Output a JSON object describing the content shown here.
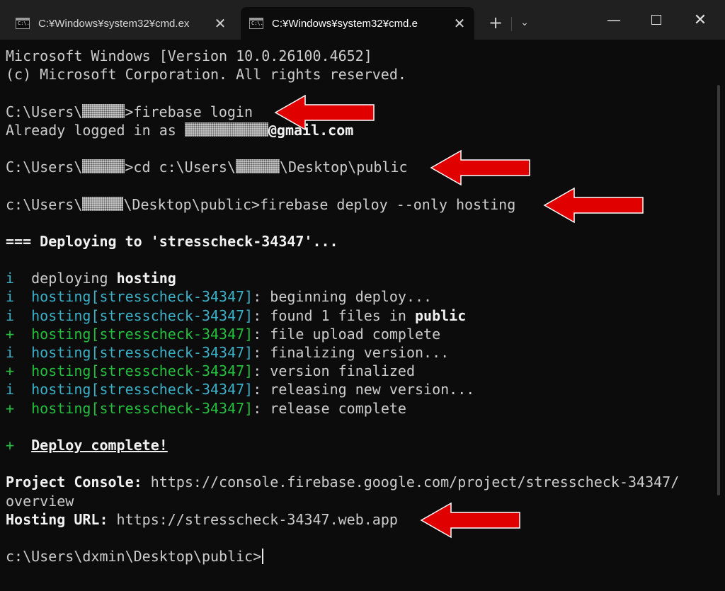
{
  "window": {
    "tabs": [
      {
        "title": "C:¥Windows¥system32¥cmd.ex",
        "close": "✕",
        "icon_text": "C:\\."
      },
      {
        "title": "C:¥Windows¥system32¥cmd.e",
        "close": "✕",
        "icon_text": "C:\\."
      }
    ],
    "new_tab": "+",
    "dropdown": "⌄",
    "minimize": "—",
    "close": "✕"
  },
  "console": {
    "l0": "Microsoft Windows [Version 10.0.26100.4652]",
    "l1": "(c) Microsoft Corporation. All rights reserved.",
    "l3_prefix": "C:\\Users\\",
    "l3_cmd": ">firebase login",
    "l4_prefix": "Already logged in as ",
    "l4_suffix": "@gmail.com",
    "l6_prefix": "C:\\Users\\",
    "l6_mid": ">cd c:\\Users\\",
    "l6_suffix": "\\Desktop\\public",
    "l8_prefix": "c:\\Users\\",
    "l8_cmd": "\\Desktop\\public>firebase deploy --only hosting",
    "l10": "=== Deploying to 'stresscheck-34347'...",
    "l12_mark": "i",
    "l12_text": "deploying ",
    "l12_bold": "hosting",
    "steps": [
      {
        "mark": "i",
        "tag": "hosting[stresscheck-34347]",
        "msg": ": beginning deploy...",
        "color": "cyan"
      },
      {
        "mark": "i",
        "tag": "hosting[stresscheck-34347]",
        "msg": ": found 1 files in ",
        "bold": "public",
        "color": "cyan"
      },
      {
        "mark": "+",
        "tag": "hosting[stresscheck-34347]",
        "msg": ": file upload complete",
        "color": "green"
      },
      {
        "mark": "i",
        "tag": "hosting[stresscheck-34347]",
        "msg": ": finalizing version...",
        "color": "cyan"
      },
      {
        "mark": "+",
        "tag": "hosting[stresscheck-34347]",
        "msg": ": version finalized",
        "color": "green"
      },
      {
        "mark": "i",
        "tag": "hosting[stresscheck-34347]",
        "msg": ": releasing new version...",
        "color": "cyan"
      },
      {
        "mark": "+",
        "tag": "hosting[stresscheck-34347]",
        "msg": ": release complete",
        "color": "green"
      }
    ],
    "l21_mark": "+",
    "l21_text": "Deploy complete!",
    "l23_label": "Project Console:",
    "l23_url": " https://console.firebase.google.com/project/stresscheck-34347/",
    "l24": "overview",
    "l25_label": "Hosting URL:",
    "l25_url": " https://stresscheck-34347.web.app",
    "l27_prompt": "c:\\Users\\dxmin\\Desktop\\public>"
  },
  "colors": {
    "background": "#0c0c0c",
    "text": "#cccccc",
    "cyan": "#3bb1c8",
    "green": "#23c03e",
    "arrow": "#e00000"
  }
}
